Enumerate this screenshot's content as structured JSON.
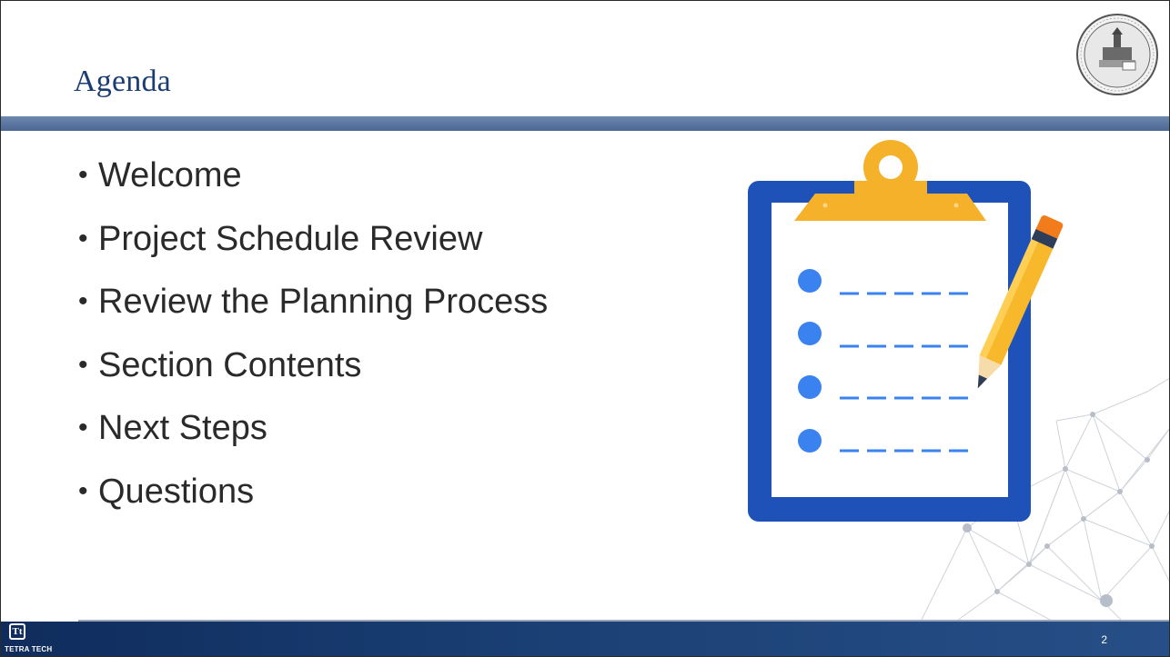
{
  "slide": {
    "title": "Agenda",
    "bullet_glyph": "•",
    "items": [
      {
        "label": "Welcome"
      },
      {
        "label": "Project Schedule Review"
      },
      {
        "label": "Review the Planning Process"
      },
      {
        "label": "Section Contents"
      },
      {
        "label": "Next Steps"
      },
      {
        "label": "Questions"
      }
    ],
    "page_number": "2"
  },
  "footer": {
    "logo_mark": "Tt",
    "logo_text": "TETRA TECH"
  },
  "colors": {
    "title": "#1b3d73",
    "title_bar": "#5a76a0",
    "footer": "#1a3f74",
    "clipboard_border": "#1f52b8",
    "clip": "#f6b12b",
    "bullet_dots": "#3a82f0",
    "pencil": "#f8b82c",
    "pencil_eraser": "#f27b1c"
  },
  "icons": {
    "seal": "county-seal-icon",
    "clipboard": "clipboard-checklist-icon",
    "pencil": "pencil-icon",
    "network": "network-mesh-decoration",
    "logo": "tetra-tech-logo"
  }
}
